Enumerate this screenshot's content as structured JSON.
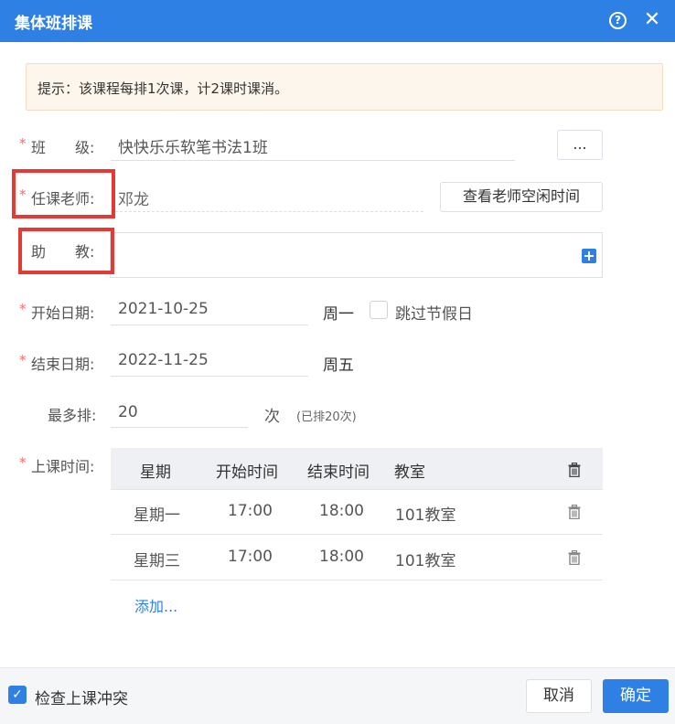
{
  "dialog": {
    "title": "集体班排课",
    "help_glyph": "?",
    "close_glyph": "✕"
  },
  "notice": "提示：该课程每排1次课，计2课时课消。",
  "form": {
    "class": {
      "label": "班　　级:",
      "value": "快快乐乐软笔书法1班",
      "picker_label": "..."
    },
    "teacher": {
      "label": "任课老师:",
      "value": "邓龙",
      "free_time_button": "查看老师空闲时间"
    },
    "assistant": {
      "label": "助　　教:"
    },
    "start_date": {
      "label": "开始日期:",
      "value": "2021-10-25",
      "weekday": "周一",
      "skip_holiday_label": "跳过节假日"
    },
    "end_date": {
      "label": "结束日期:",
      "value": "2022-11-25",
      "weekday": "周五"
    },
    "max_sessions": {
      "label": "最多排:",
      "value": "20",
      "unit": "次",
      "note": "(已排20次)"
    },
    "schedule": {
      "label": "上课时间:",
      "columns": [
        "星期",
        "开始时间",
        "结束时间",
        "教室"
      ],
      "rows": [
        [
          "星期一",
          "17:00",
          "18:00",
          "101教室"
        ],
        [
          "星期三",
          "17:00",
          "18:00",
          "101教室"
        ]
      ],
      "add_link": "添加..."
    }
  },
  "required_mark": "*",
  "footer": {
    "conflict_check_label": "检查上课冲突",
    "conflict_check_checked": true,
    "cancel_label": "取消",
    "confirm_label": "确定"
  },
  "colors": {
    "primary": "#2f80e4",
    "required": "#f56c6c",
    "highlight": "#e53935"
  }
}
